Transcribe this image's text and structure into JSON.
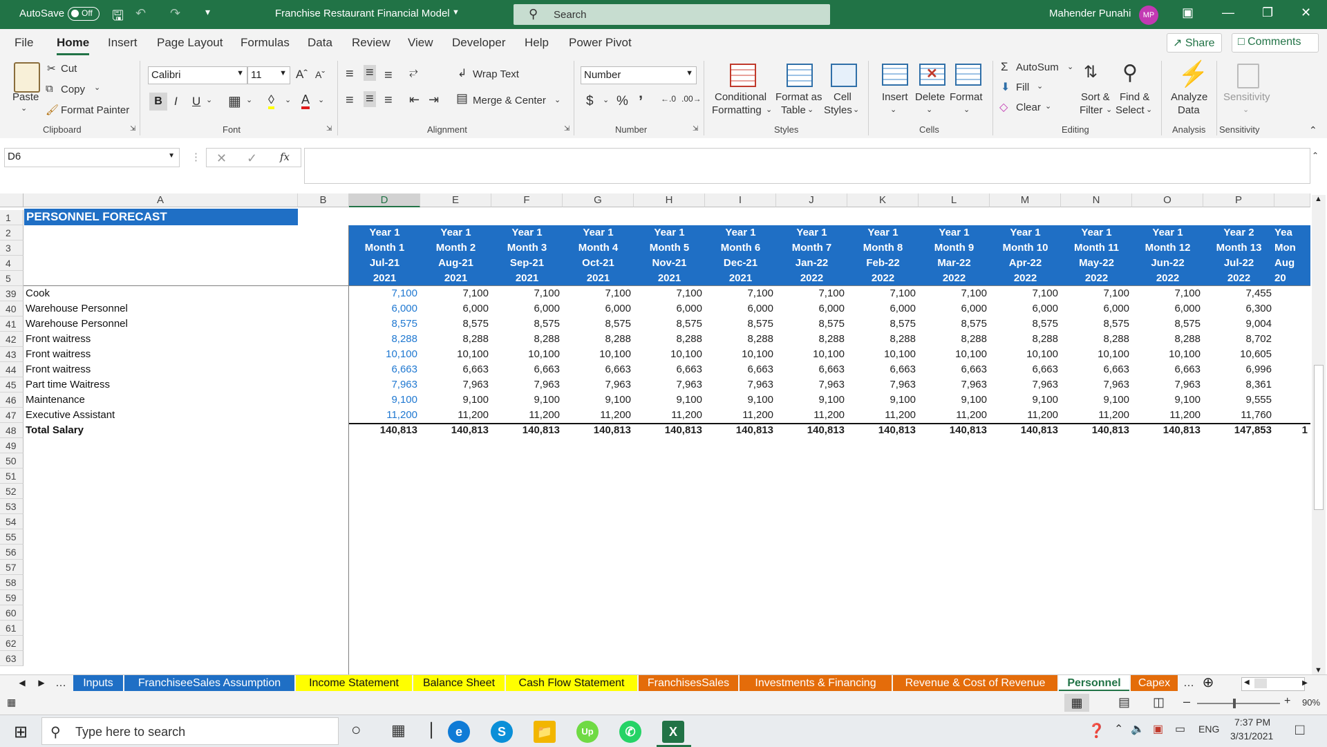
{
  "titlebar": {
    "autosave_label": "AutoSave",
    "autosave_state": "Off",
    "file_title": "Franchise  Restaurant Financial Model",
    "search_placeholder": "Search",
    "user_name": "Mahender Punahi",
    "user_initials": "MP"
  },
  "menu_tabs": [
    "File",
    "Home",
    "Insert",
    "Page Layout",
    "Formulas",
    "Data",
    "Review",
    "View",
    "Developer",
    "Help",
    "Power Pivot"
  ],
  "active_menu_tab": "Home",
  "share_label": "Share",
  "comments_label": "Comments",
  "ribbon": {
    "clipboard": {
      "paste": "Paste",
      "cut": "Cut",
      "copy": "Copy",
      "format_painter": "Format Painter",
      "group": "Clipboard"
    },
    "font": {
      "name": "Calibri",
      "size": "11",
      "group": "Font"
    },
    "alignment": {
      "wrap_text": "Wrap Text",
      "merge_center": "Merge & Center",
      "group": "Alignment"
    },
    "number": {
      "format": "Number",
      "group": "Number"
    },
    "styles": {
      "conditional": [
        "Conditional",
        "Formatting"
      ],
      "format_table": [
        "Format as",
        "Table"
      ],
      "cell_styles": [
        "Cell",
        "Styles"
      ],
      "group": "Styles"
    },
    "cells": {
      "insert": "Insert",
      "delete": "Delete",
      "format": "Format",
      "group": "Cells"
    },
    "editing": {
      "autosum": "AutoSum",
      "fill": "Fill",
      "clear": "Clear",
      "sort_filter": [
        "Sort &",
        "Filter"
      ],
      "find_select": [
        "Find &",
        "Select"
      ],
      "group": "Editing"
    },
    "analysis": {
      "analyze": [
        "Analyze",
        "Data"
      ],
      "group": "Analysis"
    },
    "sensitivity": {
      "label": "Sensitivity",
      "group": "Sensitivity"
    }
  },
  "formula_bar": {
    "name_box": "D6",
    "fx": "fx",
    "value": ""
  },
  "columns": [
    "A",
    "B",
    "D",
    "E",
    "F",
    "G",
    "H",
    "I",
    "J",
    "K",
    "L",
    "M",
    "N",
    "O",
    "P"
  ],
  "selected_column": "D",
  "sheet_title": "PERSONNEL FORECAST",
  "period_headers": [
    [
      "Year 1",
      "Month 1",
      "Jul-21",
      "2021"
    ],
    [
      "Year 1",
      "Month 2",
      "Aug-21",
      "2021"
    ],
    [
      "Year 1",
      "Month 3",
      "Sep-21",
      "2021"
    ],
    [
      "Year 1",
      "Month 4",
      "Oct-21",
      "2021"
    ],
    [
      "Year 1",
      "Month 5",
      "Nov-21",
      "2021"
    ],
    [
      "Year 1",
      "Month 6",
      "Dec-21",
      "2021"
    ],
    [
      "Year 1",
      "Month 7",
      "Jan-22",
      "2022"
    ],
    [
      "Year 1",
      "Month 8",
      "Feb-22",
      "2022"
    ],
    [
      "Year 1",
      "Month 9",
      "Mar-22",
      "2022"
    ],
    [
      "Year 1",
      "Month 10",
      "Apr-22",
      "2022"
    ],
    [
      "Year 1",
      "Month 11",
      "May-22",
      "2022"
    ],
    [
      "Year 1",
      "Month 12",
      "Jun-22",
      "2022"
    ],
    [
      "Year 2",
      "Month 13",
      "Jul-22",
      "2022"
    ]
  ],
  "partial_header": [
    "Yea",
    "Mon",
    "Aug",
    "20"
  ],
  "header_row_numbers": [
    "1",
    "2",
    "3",
    "4",
    "5"
  ],
  "rows": [
    {
      "num": "39",
      "label": "Cook",
      "values": [
        "7,100",
        "7,100",
        "7,100",
        "7,100",
        "7,100",
        "7,100",
        "7,100",
        "7,100",
        "7,100",
        "7,100",
        "7,100",
        "7,100",
        "7,455"
      ]
    },
    {
      "num": "40",
      "label": "Warehouse Personnel",
      "values": [
        "6,000",
        "6,000",
        "6,000",
        "6,000",
        "6,000",
        "6,000",
        "6,000",
        "6,000",
        "6,000",
        "6,000",
        "6,000",
        "6,000",
        "6,300"
      ]
    },
    {
      "num": "41",
      "label": "Warehouse Personnel",
      "values": [
        "8,575",
        "8,575",
        "8,575",
        "8,575",
        "8,575",
        "8,575",
        "8,575",
        "8,575",
        "8,575",
        "8,575",
        "8,575",
        "8,575",
        "9,004"
      ]
    },
    {
      "num": "42",
      "label": "Front waitress",
      "values": [
        "8,288",
        "8,288",
        "8,288",
        "8,288",
        "8,288",
        "8,288",
        "8,288",
        "8,288",
        "8,288",
        "8,288",
        "8,288",
        "8,288",
        "8,702"
      ]
    },
    {
      "num": "43",
      "label": "Front waitress",
      "values": [
        "10,100",
        "10,100",
        "10,100",
        "10,100",
        "10,100",
        "10,100",
        "10,100",
        "10,100",
        "10,100",
        "10,100",
        "10,100",
        "10,100",
        "10,605"
      ]
    },
    {
      "num": "44",
      "label": "Front waitress",
      "values": [
        "6,663",
        "6,663",
        "6,663",
        "6,663",
        "6,663",
        "6,663",
        "6,663",
        "6,663",
        "6,663",
        "6,663",
        "6,663",
        "6,663",
        "6,996"
      ]
    },
    {
      "num": "45",
      "label": "Part time Waitress",
      "values": [
        "7,963",
        "7,963",
        "7,963",
        "7,963",
        "7,963",
        "7,963",
        "7,963",
        "7,963",
        "7,963",
        "7,963",
        "7,963",
        "7,963",
        "8,361"
      ]
    },
    {
      "num": "46",
      "label": "Maintenance",
      "values": [
        "9,100",
        "9,100",
        "9,100",
        "9,100",
        "9,100",
        "9,100",
        "9,100",
        "9,100",
        "9,100",
        "9,100",
        "9,100",
        "9,100",
        "9,555"
      ]
    },
    {
      "num": "47",
      "label": "Executive Assistant",
      "values": [
        "11,200",
        "11,200",
        "11,200",
        "11,200",
        "11,200",
        "11,200",
        "11,200",
        "11,200",
        "11,200",
        "11,200",
        "11,200",
        "11,200",
        "11,760"
      ]
    }
  ],
  "total_row": {
    "num": "48",
    "label": "Total Salary",
    "values": [
      "140,813",
      "140,813",
      "140,813",
      "140,813",
      "140,813",
      "140,813",
      "140,813",
      "140,813",
      "140,813",
      "140,813",
      "140,813",
      "140,813",
      "147,853"
    ],
    "partial": "1"
  },
  "empty_rows": [
    "49",
    "50",
    "51",
    "52",
    "53",
    "54",
    "55",
    "56",
    "57",
    "58",
    "59",
    "60",
    "61",
    "62",
    "63"
  ],
  "sheet_tabs": [
    {
      "label": "Inputs",
      "color": "#1f6fc5",
      "text": "#ffffff"
    },
    {
      "label": "FranchiseeSales Assumption",
      "color": "#1f6fc5",
      "text": "#ffffff"
    },
    {
      "label": "Income Statement",
      "color": "#ffff00",
      "text": "#111111"
    },
    {
      "label": "Balance Sheet",
      "color": "#ffff00",
      "text": "#111111"
    },
    {
      "label": "Cash Flow Statement",
      "color": "#ffff00",
      "text": "#111111"
    },
    {
      "label": "FranchisesSales",
      "color": "#e46c0a",
      "text": "#ffffff"
    },
    {
      "label": "Investments & Financing",
      "color": "#e46c0a",
      "text": "#ffffff"
    },
    {
      "label": "Revenue & Cost of Revenue",
      "color": "#e46c0a",
      "text": "#ffffff"
    },
    {
      "label": "Personnel",
      "color": "#ffffff",
      "text": "#217346"
    },
    {
      "label": "Capex",
      "color": "#e46c0a",
      "text": "#ffffff"
    }
  ],
  "status": {
    "zoom": "90%"
  },
  "taskbar": {
    "search_placeholder": "Type here to search",
    "lang": "ENG",
    "time": "7:37 PM",
    "date": "3/31/2021"
  },
  "colors": {
    "excel_green": "#217346",
    "header_blue": "#1f6fc5",
    "input_blue": "#1f78d1"
  }
}
